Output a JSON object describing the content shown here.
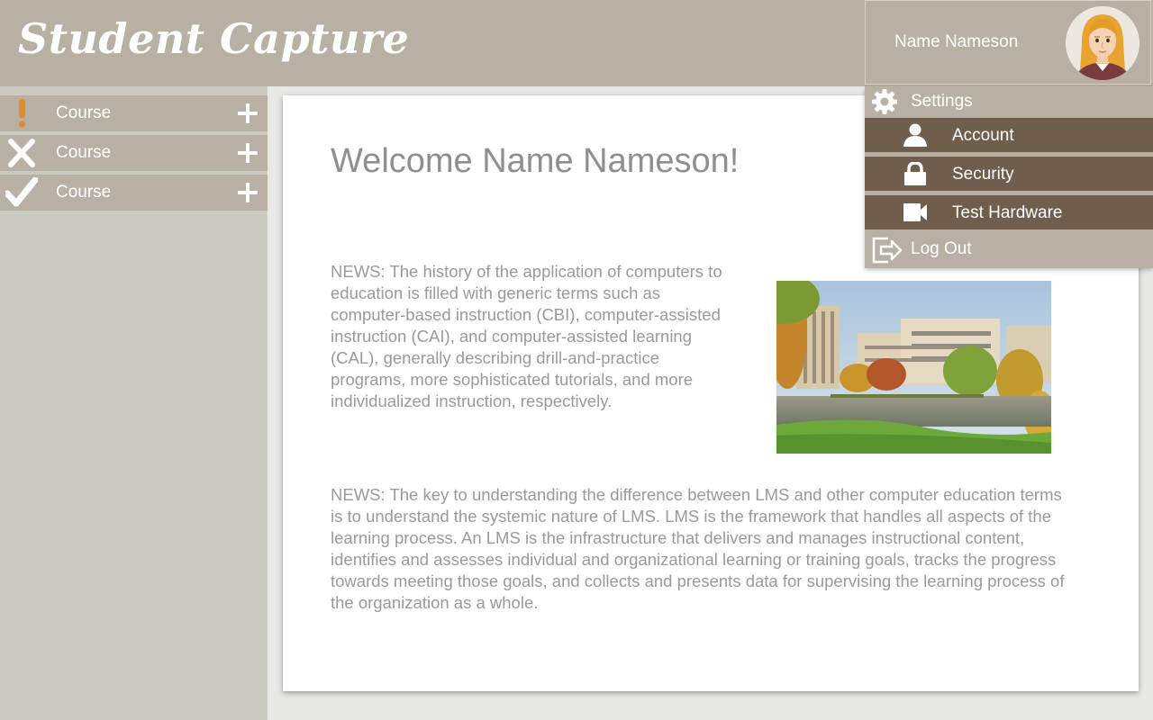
{
  "app": {
    "logo_text": "Student Capture"
  },
  "sidebar": {
    "courses": [
      {
        "label": "Course",
        "status": "warning",
        "status_color": "#e08a2c"
      },
      {
        "label": "Course",
        "status": "failed",
        "status_color": "#ffffff"
      },
      {
        "label": "Course",
        "status": "completed",
        "status_color": "#ffffff"
      }
    ],
    "expand_icon": "plus-icon"
  },
  "user": {
    "name": "Name Nameson",
    "avatar_icon": "user-avatar"
  },
  "menu": {
    "settings_label": "Settings",
    "items": [
      {
        "label": "Account",
        "icon": "person-icon"
      },
      {
        "label": "Security",
        "icon": "lock-icon"
      },
      {
        "label": "Test Hardware",
        "icon": "camera-icon"
      }
    ],
    "logout_label": "Log Out"
  },
  "main": {
    "welcome": "Welcome Name Nameson!",
    "news": [
      "NEWS: The history of the application of computers to education is filled with generic terms such as computer-based instruction (CBI), computer-assisted instruction (CAI), and computer-assisted learning (CAL), generally describing drill-and-practice programs, more sophisticated tutorials, and more individualized instruction, respectively.",
      "NEWS: The key to understanding the difference between LMS and other computer education terms is to understand the systemic nature of LMS. LMS is the framework that handles all aspects of the learning process. An LMS is the infrastructure that delivers and manages instructional content, identifies and assesses individual and organizational learning or training goals, tracks the progress towards meeting those goals, and collects and presents data for supervising the learning process of the organization as a whole."
    ],
    "image_icon": "campus-photo"
  },
  "colors": {
    "header": "#b8b0a3",
    "sidebar": "#cacac1",
    "submenu": "#6e5e4b",
    "warning": "#e08a2c"
  }
}
